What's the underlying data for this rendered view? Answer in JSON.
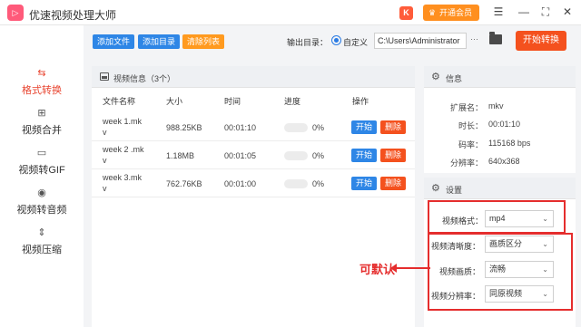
{
  "app": {
    "title": "优速视频处理大师",
    "logo_glyph": "▷",
    "vip_label": "开通会员",
    "k_glyph": "K"
  },
  "window_controls": {
    "menu": "☰",
    "minimize": "—",
    "maximize": "⛶",
    "close": "✕"
  },
  "sidebar": {
    "items": [
      {
        "label": "格式转换",
        "icon": "format-convert-icon",
        "glyph": "⇆",
        "active": true
      },
      {
        "label": "视频合并",
        "icon": "video-merge-icon",
        "glyph": "⊞"
      },
      {
        "label": "视频转GIF",
        "icon": "gif-icon",
        "glyph": "▭"
      },
      {
        "label": "视频转音频",
        "icon": "audio-icon",
        "glyph": "◉"
      },
      {
        "label": "视频压缩",
        "icon": "compress-icon",
        "glyph": "⇕"
      }
    ]
  },
  "toolbar": {
    "add_file": "添加文件",
    "add_dir": "添加目录",
    "clear_list": "清除列表",
    "output_label": "输出目录：",
    "custom_label": "自定义",
    "output_path": "C:\\Users\\Administrator",
    "path_more": "···",
    "start_all": "开始转换"
  },
  "file_panel": {
    "title": "视频信息（3个）",
    "columns": {
      "name": "文件名称",
      "size": "大小",
      "time": "时间",
      "progress": "进度",
      "action": "操作"
    },
    "rows": [
      {
        "name_line1": "week 1.mk",
        "name_line2": "v",
        "size": "988.25KB",
        "time": "00:01:10",
        "progress": "0%",
        "start": "开始",
        "delete": "删除"
      },
      {
        "name_line1": "week 2 .mk",
        "name_line2": "v",
        "size": "1.18MB",
        "time": "00:01:05",
        "progress": "0%",
        "start": "开始",
        "delete": "删除"
      },
      {
        "name_line1": "week 3.mk",
        "name_line2": "v",
        "size": "762.76KB",
        "time": "00:01:00",
        "progress": "0%",
        "start": "开始",
        "delete": "删除"
      }
    ]
  },
  "info_panel": {
    "title": "信息",
    "fields": [
      {
        "key": "扩展名：",
        "value": "mkv"
      },
      {
        "key": "时长：",
        "value": "00:01:10"
      },
      {
        "key": "码率：",
        "value": "115168 bps"
      },
      {
        "key": "分辨率：",
        "value": "640x368"
      }
    ]
  },
  "settings_panel": {
    "title": "设置",
    "format_label": "视频格式：",
    "format_value": "mp4",
    "clarity_label": "视频清晰度：",
    "clarity_value": "画质区分",
    "quality_label": "视频画质：",
    "quality_value": "流畅",
    "resolution_label": "视频分辨率：",
    "resolution_value": "同原视频"
  },
  "annotation": {
    "text": "可默认"
  },
  "colors": {
    "accent_red": "#f4511e",
    "blue": "#2e86e6",
    "orange": "#ff8f1f",
    "highlight": "#e52d2d"
  }
}
